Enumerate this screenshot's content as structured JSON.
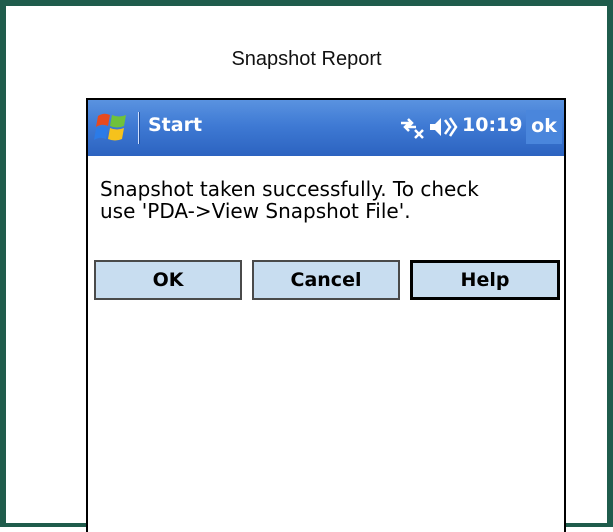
{
  "report": {
    "title": "Snapshot Report"
  },
  "taskbar": {
    "start_label": "Start",
    "clock": "10:19",
    "ok_label": "ok",
    "icons": [
      "windows-flag-icon",
      "connectivity-icon",
      "volume-icon"
    ]
  },
  "dialog": {
    "message": "Snapshot taken successfully.  To check\nuse 'PDA->View Snapshot File'.",
    "buttons": {
      "ok": "OK",
      "cancel": "Cancel",
      "help": "Help"
    }
  },
  "colors": {
    "frame_border": "#1f5c4c",
    "taskbar_blue": "#3f7ad4",
    "button_fill": "#c8ddf0"
  }
}
